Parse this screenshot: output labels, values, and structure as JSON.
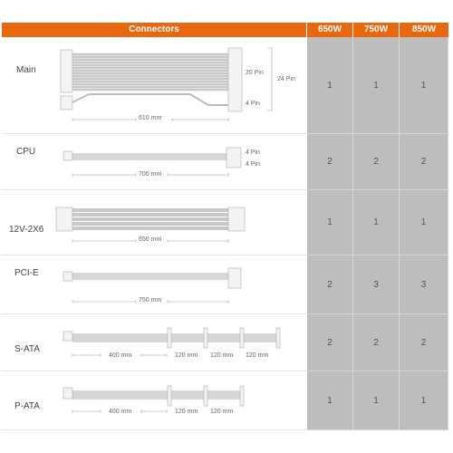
{
  "header": {
    "connectors": "Connectors",
    "columns": [
      "650W",
      "750W",
      "850W"
    ]
  },
  "accent_color": "#e8670f",
  "rows": [
    {
      "name": "Main",
      "counts": [
        "1",
        "1",
        "1"
      ],
      "length": "610 mm",
      "pins": [
        "20 Pin",
        "4 Pin",
        "24 Pin"
      ]
    },
    {
      "name": "CPU",
      "counts": [
        "2",
        "2",
        "2"
      ],
      "length": "700 mm",
      "pins": [
        "4 Pin",
        "4 Pin"
      ]
    },
    {
      "name": "12V-2X6",
      "counts": [
        "1",
        "1",
        "1"
      ],
      "length": "650 mm"
    },
    {
      "name": "PCI-E",
      "counts": [
        "2",
        "3",
        "3"
      ],
      "length": "750 mm"
    },
    {
      "name": "S-ATA",
      "counts": [
        "2",
        "2",
        "2"
      ],
      "length": "400 mm",
      "segments": [
        "120 mm",
        "120 mm",
        "120 mm"
      ]
    },
    {
      "name": "P-ATA",
      "counts": [
        "1",
        "1",
        "1"
      ],
      "length": "400 mm",
      "segments": [
        "120 mm",
        "120 mm"
      ]
    }
  ]
}
